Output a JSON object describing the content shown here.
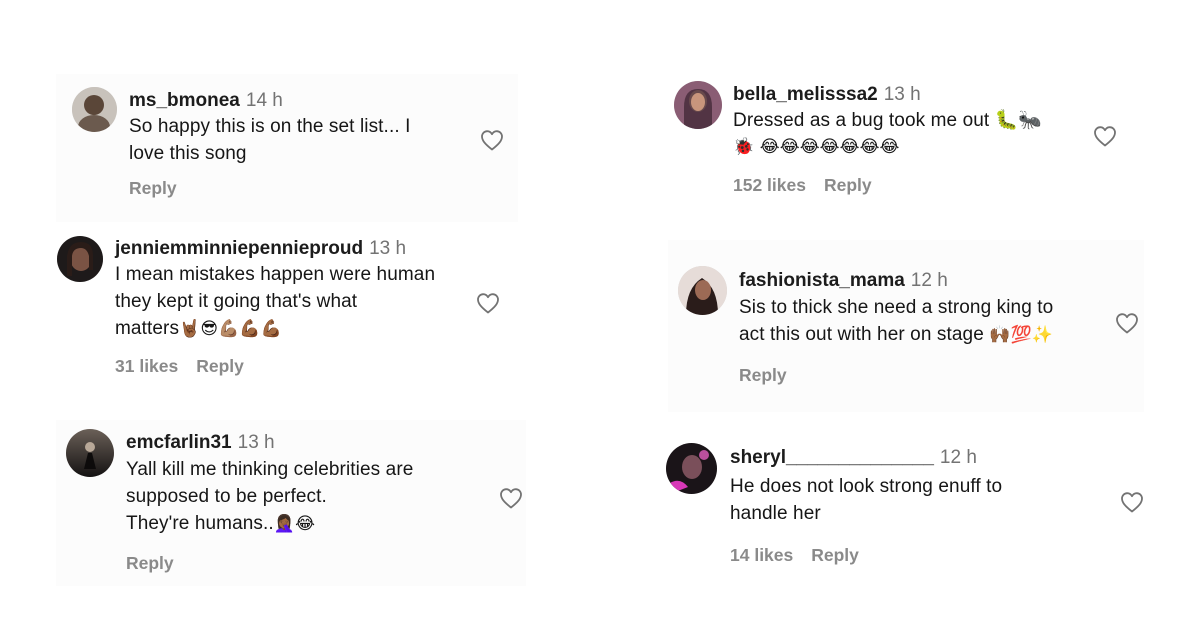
{
  "comments": [
    {
      "username": "ms_bmonea",
      "time": "14 h",
      "lines": [
        "So happy this is on the set list... I",
        "love this song"
      ],
      "likes": "",
      "reply": "Reply",
      "avatar_color": "#6b5a4e"
    },
    {
      "username": "jenniemminniepennieproud",
      "time": "13 h",
      "lines": [
        "I mean mistakes happen were human",
        "they kept it going that's what",
        "matters"
      ],
      "emoji_tail": "🤘🏾😎💪🏽💪🏾💪🏾",
      "likes": "31 likes",
      "reply": "Reply",
      "avatar_color": "#3b2a25"
    },
    {
      "username": "emcfarlin31",
      "time": "13 h",
      "lines": [
        "Yall kill me thinking celebrities are",
        "supposed to be perfect.",
        "They're humans.."
      ],
      "emoji_tail": "🤦🏾‍♀️😂",
      "likes": "",
      "reply": "Reply",
      "avatar_color": "#2b2422"
    },
    {
      "username": "bella_melisssa2",
      "time": "13 h",
      "lines": [
        "Dressed as a bug took me out 🐛🐜",
        "🐞 😂😂😂😂😂😂😂"
      ],
      "likes": "152 likes",
      "reply": "Reply",
      "avatar_color": "#6d4a5a"
    },
    {
      "username": "fashionista_mama",
      "time": "12 h",
      "lines": [
        "Sis to thick she need a strong king to",
        "act this out with her on stage"
      ],
      "emoji_tail": "🙌🏾💯✨",
      "likes": "",
      "reply": "Reply",
      "avatar_color": "#4a3a38"
    },
    {
      "username": "sheryl______________",
      "time": "12 h",
      "lines": [
        "He does not look strong enuff to",
        "handle her"
      ],
      "likes": "14 likes",
      "reply": "Reply",
      "avatar_color": "#5e4a5c"
    }
  ],
  "icons": {
    "heart": "heart-outline-icon"
  }
}
